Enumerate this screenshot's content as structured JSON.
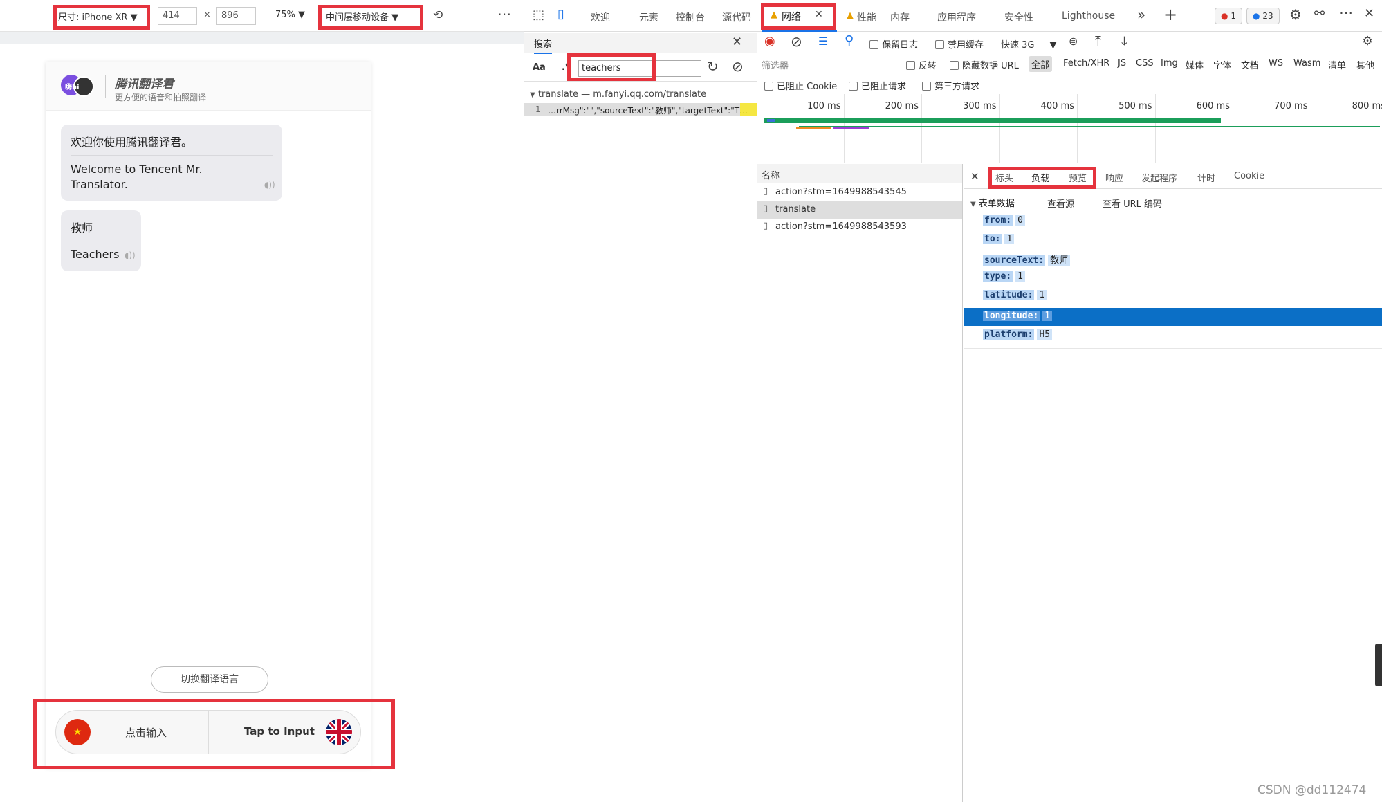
{
  "device_bar": {
    "device": "尺寸: iPhone XR ▼",
    "width": "414",
    "times": "×",
    "height": "896",
    "zoom": "75% ▼",
    "throttle": "中间层移动设备 ▼",
    "more": "⋯"
  },
  "phone": {
    "logo_badge": "嗨hi",
    "app_name": "腾讯翻译君",
    "app_slogan": "更方便的语音和拍照翻译",
    "msg1_zh": "欢迎你使用腾讯翻译君。",
    "msg1_en": "Welcome to Tencent Mr. Translator.",
    "msg2_zh": "教师",
    "msg2_en": "Teachers",
    "switch_lang": "切换翻译语言",
    "input_zh": "点击输入",
    "input_en": "Tap to Input"
  },
  "devtools_tabs": {
    "welcome": "欢迎",
    "elements": "元素",
    "console": "控制台",
    "sources": "源代码",
    "network": "网络",
    "performance": "性能",
    "memory": "内存",
    "application": "应用程序",
    "security": "安全性",
    "lighthouse": "Lighthouse",
    "errors": "1",
    "messages": "23"
  },
  "search_panel": {
    "title": "搜索",
    "case": "Aa",
    "regex": ".*",
    "query": "teachers",
    "result_file": "translate — m.fanyi.qq.com/translate",
    "result_line_no": "1",
    "result_text": "…rrMsg\":\"\",\"sourceText\":\"教师\",\"targetText\":\"T…"
  },
  "network": {
    "preserve_log": "保留日志",
    "disable_cache": "禁用缓存",
    "throttle": "快速 3G",
    "filter_placeholder": "筛选器",
    "invert": "反转",
    "hide_data_urls": "隐藏数据 URL",
    "types": [
      "全部",
      "Fetch/XHR",
      "JS",
      "CSS",
      "Img",
      "媒体",
      "字体",
      "文档",
      "WS",
      "Wasm",
      "清单",
      "其他"
    ],
    "blocked_cookies": "已阻止 Cookie",
    "blocked_requests": "已阻止请求",
    "third_party": "第三方请求",
    "timeline_ticks": [
      "100 ms",
      "200 ms",
      "300 ms",
      "400 ms",
      "500 ms",
      "600 ms",
      "700 ms",
      "800 ms"
    ],
    "name_header": "名称",
    "requests": [
      "action?stm=1649988543545",
      "translate",
      "action?stm=1649988543593"
    ]
  },
  "detail": {
    "tabs": [
      "标头",
      "负载",
      "预览",
      "响应",
      "发起程序",
      "计时",
      "Cookie"
    ],
    "section": "表单数据",
    "view_source": "查看源",
    "view_url_encoded": "查看 URL 编码",
    "fields": [
      {
        "k": "from:",
        "v": "0"
      },
      {
        "k": "to:",
        "v": "1"
      },
      {
        "k": "sourceText:",
        "v": "教师"
      },
      {
        "k": "type:",
        "v": "1"
      },
      {
        "k": "latitude:",
        "v": "1"
      },
      {
        "k": "longitude:",
        "v": "1"
      },
      {
        "k": "platform:",
        "v": "H5"
      }
    ]
  },
  "watermark": "CSDN @dd112474",
  "colors": {
    "highlight": "#e5333d",
    "selected_row": "#0b6fc6",
    "accent": "#1a73e8"
  }
}
